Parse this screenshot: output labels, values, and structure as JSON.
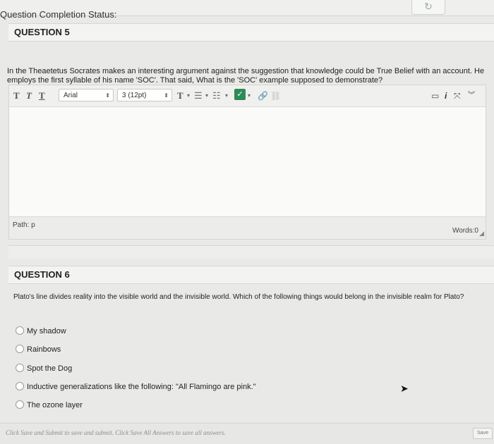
{
  "page": {
    "status_title": "Question Completion Status:"
  },
  "question5": {
    "header": "QUESTION 5",
    "text": "In the Theaetetus Socrates makes an interesting argument against the suggestion that knowledge could be True Belief with an account. He employs the first syllable of his name 'SOC'. That said, What is the 'SOC' example supposed to demonstrate?"
  },
  "editor": {
    "toolbar": {
      "bold": "T",
      "italic": "T",
      "underline": "T",
      "font_family": "Arial",
      "font_size": "3 (12pt)",
      "text_color": "T"
    },
    "path_label": "Path: p",
    "words_label": "Words:0"
  },
  "question6": {
    "header": "QUESTION 6",
    "text": "Plato's line divides reality into the visible world and the invisible world. Which of the following things would belong in the invisible realm for Plato?",
    "options": [
      "My shadow",
      "Rainbows",
      "Spot the Dog",
      "Inductive generalizations like the following: \"All Flamingo are pink.\"",
      "The ozone layer"
    ]
  },
  "footer": {
    "instructions": "Click Save and Submit to save and submit. Click Save All Answers to save all answers.",
    "save_label": "Save"
  },
  "colors": {
    "accent_check": "#2e8b57",
    "page_bg": "#e9e9e7"
  }
}
